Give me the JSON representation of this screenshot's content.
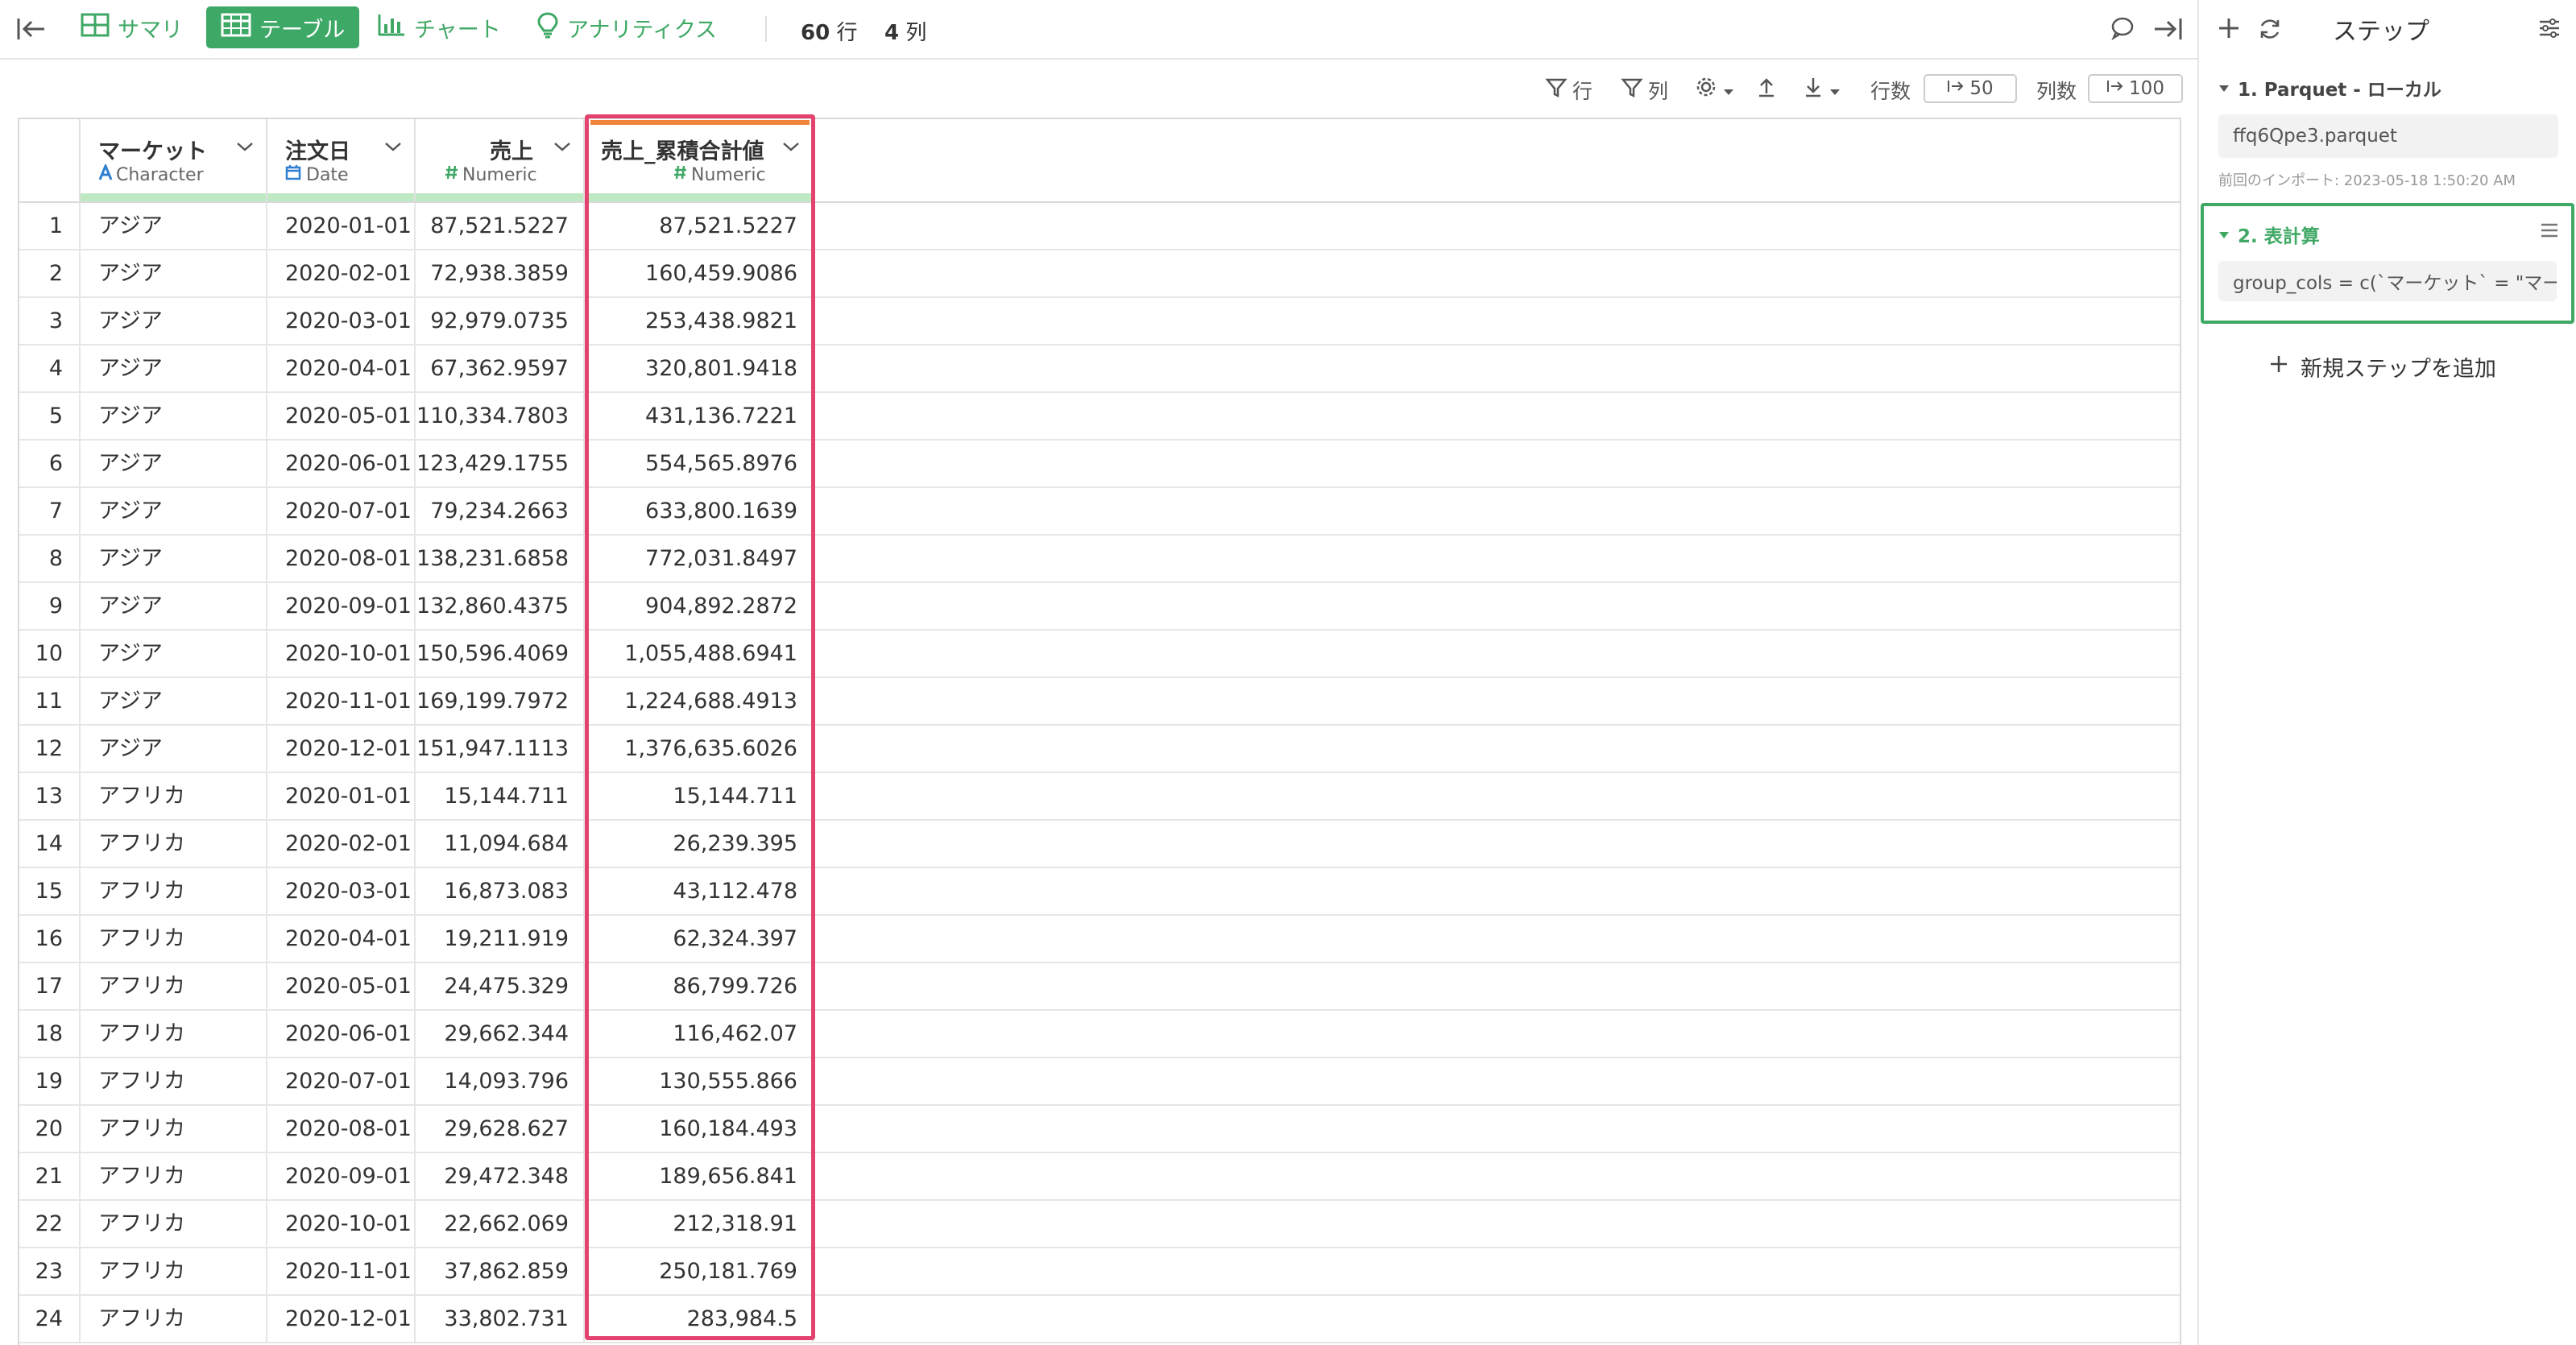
{
  "toolbar": {
    "tabs": [
      {
        "label": "サマリ",
        "icon": "grid-icon"
      },
      {
        "label": "テーブル",
        "icon": "table-icon",
        "active": true
      },
      {
        "label": "チャート",
        "icon": "bar-chart-icon"
      },
      {
        "label": "アナリティクス",
        "icon": "lightbulb-icon"
      }
    ],
    "rows_count": "60",
    "rows_unit": "行",
    "cols_count": "4",
    "cols_unit": "列",
    "accent_color": "#3ea867"
  },
  "subbar": {
    "row_filter": "行",
    "col_filter": "列",
    "rows_label": "行数",
    "rows_value": "50",
    "cols_label": "列数",
    "cols_value": "100"
  },
  "table": {
    "columns": [
      {
        "name": "マーケット",
        "type": "Character",
        "type_icon": "character-icon"
      },
      {
        "name": "注文日",
        "type": "Date",
        "type_icon": "calendar-icon"
      },
      {
        "name": "売上",
        "type": "Numeric",
        "type_icon": "hash-icon"
      },
      {
        "name": "売上_累積合計値",
        "type": "Numeric",
        "type_icon": "hash-icon"
      }
    ],
    "rows": [
      [
        "1",
        "アジア",
        "2020-01-01",
        "87,521.5227",
        "87,521.5227"
      ],
      [
        "2",
        "アジア",
        "2020-02-01",
        "72,938.3859",
        "160,459.9086"
      ],
      [
        "3",
        "アジア",
        "2020-03-01",
        "92,979.0735",
        "253,438.9821"
      ],
      [
        "4",
        "アジア",
        "2020-04-01",
        "67,362.9597",
        "320,801.9418"
      ],
      [
        "5",
        "アジア",
        "2020-05-01",
        "110,334.7803",
        "431,136.7221"
      ],
      [
        "6",
        "アジア",
        "2020-06-01",
        "123,429.1755",
        "554,565.8976"
      ],
      [
        "7",
        "アジア",
        "2020-07-01",
        "79,234.2663",
        "633,800.1639"
      ],
      [
        "8",
        "アジア",
        "2020-08-01",
        "138,231.6858",
        "772,031.8497"
      ],
      [
        "9",
        "アジア",
        "2020-09-01",
        "132,860.4375",
        "904,892.2872"
      ],
      [
        "10",
        "アジア",
        "2020-10-01",
        "150,596.4069",
        "1,055,488.6941"
      ],
      [
        "11",
        "アジア",
        "2020-11-01",
        "169,199.7972",
        "1,224,688.4913"
      ],
      [
        "12",
        "アジア",
        "2020-12-01",
        "151,947.1113",
        "1,376,635.6026"
      ],
      [
        "13",
        "アフリカ",
        "2020-01-01",
        "15,144.711",
        "15,144.711"
      ],
      [
        "14",
        "アフリカ",
        "2020-02-01",
        "11,094.684",
        "26,239.395"
      ],
      [
        "15",
        "アフリカ",
        "2020-03-01",
        "16,873.083",
        "43,112.478"
      ],
      [
        "16",
        "アフリカ",
        "2020-04-01",
        "19,211.919",
        "62,324.397"
      ],
      [
        "17",
        "アフリカ",
        "2020-05-01",
        "24,475.329",
        "86,799.726"
      ],
      [
        "18",
        "アフリカ",
        "2020-06-01",
        "29,662.344",
        "116,462.07"
      ],
      [
        "19",
        "アフリカ",
        "2020-07-01",
        "14,093.796",
        "130,555.866"
      ],
      [
        "20",
        "アフリカ",
        "2020-08-01",
        "29,628.627",
        "160,184.493"
      ],
      [
        "21",
        "アフリカ",
        "2020-09-01",
        "29,472.348",
        "189,656.841"
      ],
      [
        "22",
        "アフリカ",
        "2020-10-01",
        "22,662.069",
        "212,318.91"
      ],
      [
        "23",
        "アフリカ",
        "2020-11-01",
        "37,862.859",
        "250,181.769"
      ],
      [
        "24",
        "アフリカ",
        "2020-12-01",
        "33,802.731",
        "283,984.5"
      ]
    ],
    "highlight_color": "#e4426f"
  },
  "panel": {
    "title": "ステップ",
    "steps": [
      {
        "title": "1. Parquet - ローカル",
        "content": "ffq6Qpe3.parquet",
        "note": "前回のインポート: 2023-05-18 1:50:20 AM"
      },
      {
        "title": "2. 表計算",
        "content": "group_cols = c(`マーケット` = \"マー…"
      }
    ],
    "add_step": "新規ステップを追加"
  }
}
